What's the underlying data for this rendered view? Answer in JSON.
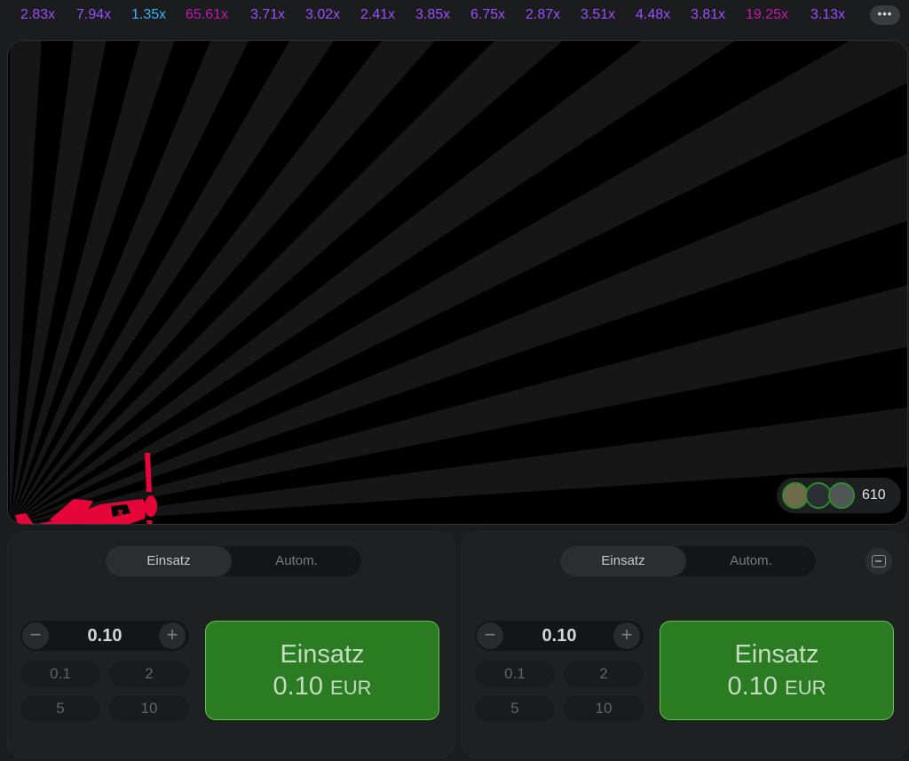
{
  "history": {
    "multipliers": [
      {
        "value": "2.83x",
        "color": "#9b4dff"
      },
      {
        "value": "7.94x",
        "color": "#9b4dff"
      },
      {
        "value": "1.35x",
        "color": "#34b4ff"
      },
      {
        "value": "65.61x",
        "color": "#c017b4"
      },
      {
        "value": "3.71x",
        "color": "#9b4dff"
      },
      {
        "value": "3.02x",
        "color": "#9b4dff"
      },
      {
        "value": "2.41x",
        "color": "#9b4dff"
      },
      {
        "value": "3.85x",
        "color": "#9b4dff"
      },
      {
        "value": "6.75x",
        "color": "#9b4dff"
      },
      {
        "value": "2.87x",
        "color": "#9b4dff"
      },
      {
        "value": "3.51x",
        "color": "#9b4dff"
      },
      {
        "value": "4.48x",
        "color": "#9b4dff"
      },
      {
        "value": "3.81x",
        "color": "#9b4dff"
      },
      {
        "value": "19.25x",
        "color": "#c017b4"
      },
      {
        "value": "3.13x",
        "color": "#9b4dff"
      }
    ],
    "more_label": "•••"
  },
  "game": {
    "plane_color": "#e50539",
    "players_count": "610"
  },
  "panels": [
    {
      "tabs": [
        "Einsatz",
        "Autom."
      ],
      "active_tab": 0,
      "amount": "0.10",
      "minus": "−",
      "plus": "+",
      "quick": [
        "0.1",
        "2",
        "5",
        "10"
      ],
      "bet_label": "Einsatz",
      "bet_amount": "0.10",
      "bet_currency": "EUR"
    },
    {
      "tabs": [
        "Einsatz",
        "Autom."
      ],
      "active_tab": 0,
      "amount": "0.10",
      "minus": "−",
      "plus": "+",
      "quick": [
        "0.1",
        "2",
        "5",
        "10"
      ],
      "bet_label": "Einsatz",
      "bet_amount": "0.10",
      "bet_currency": "EUR"
    }
  ],
  "colors": {
    "bet_button": "#2a7b22",
    "bet_border": "#5ec24e"
  }
}
